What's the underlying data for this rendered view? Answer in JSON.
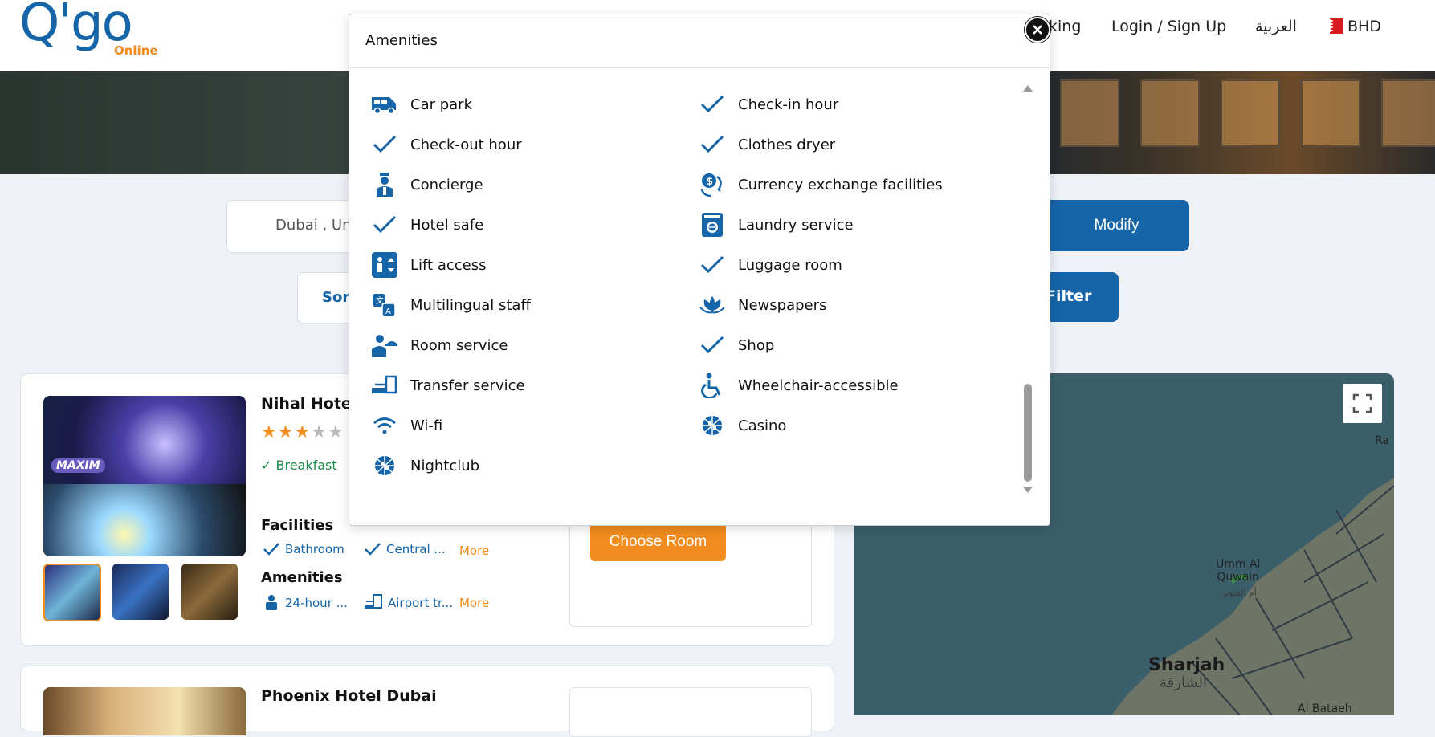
{
  "header": {
    "logo_main": "Q'go",
    "logo_sub": "Online",
    "nav_booking": "king",
    "nav_login": "Login / Sign Up",
    "nav_language": "العربية",
    "nav_currency": "BHD"
  },
  "search": {
    "destination": "Dubai , Uni",
    "modify_label": "Modify",
    "sort_label": "Sort",
    "filter_label": "Filter"
  },
  "hotels": [
    {
      "name": "Nihal Hotel",
      "stars": 3,
      "max_stars": 5,
      "breakfast": "Breakfast",
      "photo_text": "MAXIM",
      "facilities_title": "Facilities",
      "facilities": [
        "Bathroom",
        "Central ..."
      ],
      "amenities_title": "Amenities",
      "amenities": [
        "24-hour ...",
        "Airport tr..."
      ],
      "more_label": "More",
      "choose_label": "Choose Room"
    },
    {
      "name": "Phoenix Hotel Dubai"
    }
  ],
  "map": {
    "labels": {
      "ra": "Ra",
      "umm_al_quwain": "Umm Al\nQuwain",
      "umm_al_quwain_ar": "أم القيوين",
      "sharjah": "Sharjah",
      "sharjah_ar": "الشارقة",
      "al_bataeh": "Al Bataeh"
    }
  },
  "modal": {
    "title": "Amenities",
    "left": [
      {
        "label": "Car park",
        "icon": "car-park-icon"
      },
      {
        "label": "Check-out hour",
        "icon": "check-icon"
      },
      {
        "label": "Concierge",
        "icon": "concierge-icon"
      },
      {
        "label": "Hotel safe",
        "icon": "check-icon"
      },
      {
        "label": "Lift access",
        "icon": "lift-icon"
      },
      {
        "label": "Multilingual staff",
        "icon": "translate-icon"
      },
      {
        "label": "Room service",
        "icon": "room-service-icon"
      },
      {
        "label": "Transfer service",
        "icon": "transfer-icon"
      },
      {
        "label": "Wi-fi",
        "icon": "wifi-icon"
      },
      {
        "label": "Nightclub",
        "icon": "disco-ball-icon"
      }
    ],
    "right": [
      {
        "label": "Check-in hour",
        "icon": "check-icon"
      },
      {
        "label": "Clothes dryer",
        "icon": "check-icon"
      },
      {
        "label": "Currency exchange facilities",
        "icon": "currency-exchange-icon"
      },
      {
        "label": "Laundry service",
        "icon": "laundry-icon"
      },
      {
        "label": "Luggage room",
        "icon": "check-icon"
      },
      {
        "label": "Newspapers",
        "icon": "lotus-icon"
      },
      {
        "label": "Shop",
        "icon": "check-icon"
      },
      {
        "label": "Wheelchair-accessible",
        "icon": "wheelchair-icon"
      },
      {
        "label": "Casino",
        "icon": "casino-icon"
      }
    ]
  },
  "colors": {
    "brand_blue": "#1565a8",
    "brand_orange": "#f28c1e",
    "success_green": "#1b8a4a"
  }
}
